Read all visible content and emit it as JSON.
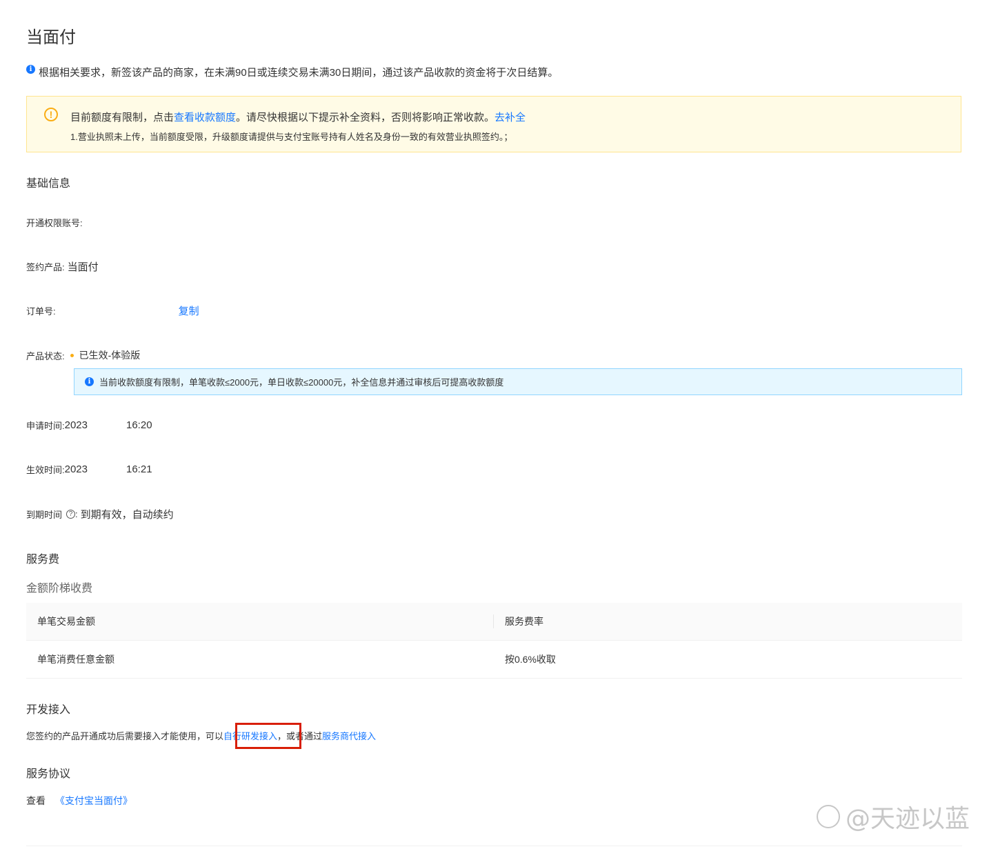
{
  "page": {
    "title": "当面付",
    "notice": "根据相关要求，新签该产品的商家，在未满90日或连续交易未满30日期间，通过该产品收款的资金将于次日结算。"
  },
  "warning": {
    "line1_prefix": "目前额度有限制，点击",
    "line1_link": "查看收款额度",
    "line1_middle": "。请尽快根据以下提示补全资料，否则将影响正常收款。",
    "line1_action": "去补全",
    "line2": "1.营业执照未上传，当前额度受限，升级额度请提供与支付宝账号持有人姓名及身份一致的有效营业执照签约。；"
  },
  "basic_info": {
    "title": "基础信息",
    "account_label": "开通权限账号:",
    "product_label": "签约产品:",
    "product_value": "当面付",
    "order_label": "订单号:",
    "copy_label": "复制",
    "status_label": "产品状态:",
    "status_value": "已生效-体验版",
    "limit_notice": "当前收款额度有限制，单笔收款≤2000元，单日收款≤20000元，补全信息并通过审核后可提高收款额度",
    "apply_label": "申请时间:",
    "apply_date": "2023",
    "apply_time": "16:20",
    "effective_label": "生效时间:",
    "effective_date": "2023",
    "effective_time": "16:21",
    "expire_label": "到期时间",
    "expire_value": "到期有效，自动续约"
  },
  "service_fee": {
    "title": "服务费",
    "subtitle": "金额阶梯收费",
    "columns": [
      "单笔交易金额",
      "服务费率"
    ],
    "rows": [
      [
        "单笔消费任意金额",
        "按0.6%收取"
      ]
    ]
  },
  "dev": {
    "title": "开发接入",
    "text_prefix": "您签约的产品开通成功后需要接入才能使用，可以",
    "self_dev_link": "自行研发接入",
    "text_middle": "，或者通过",
    "agent_link": "服务商代接入"
  },
  "agreement": {
    "title": "服务协议",
    "view_label": "查看",
    "doc_link": "《支付宝当面付》"
  },
  "watermark": "@天迹以蓝",
  "colors": {
    "link": "#1677ff",
    "warning_bg": "#fffbe6",
    "info_bg": "#e6f7ff",
    "highlight": "#d81e06"
  }
}
